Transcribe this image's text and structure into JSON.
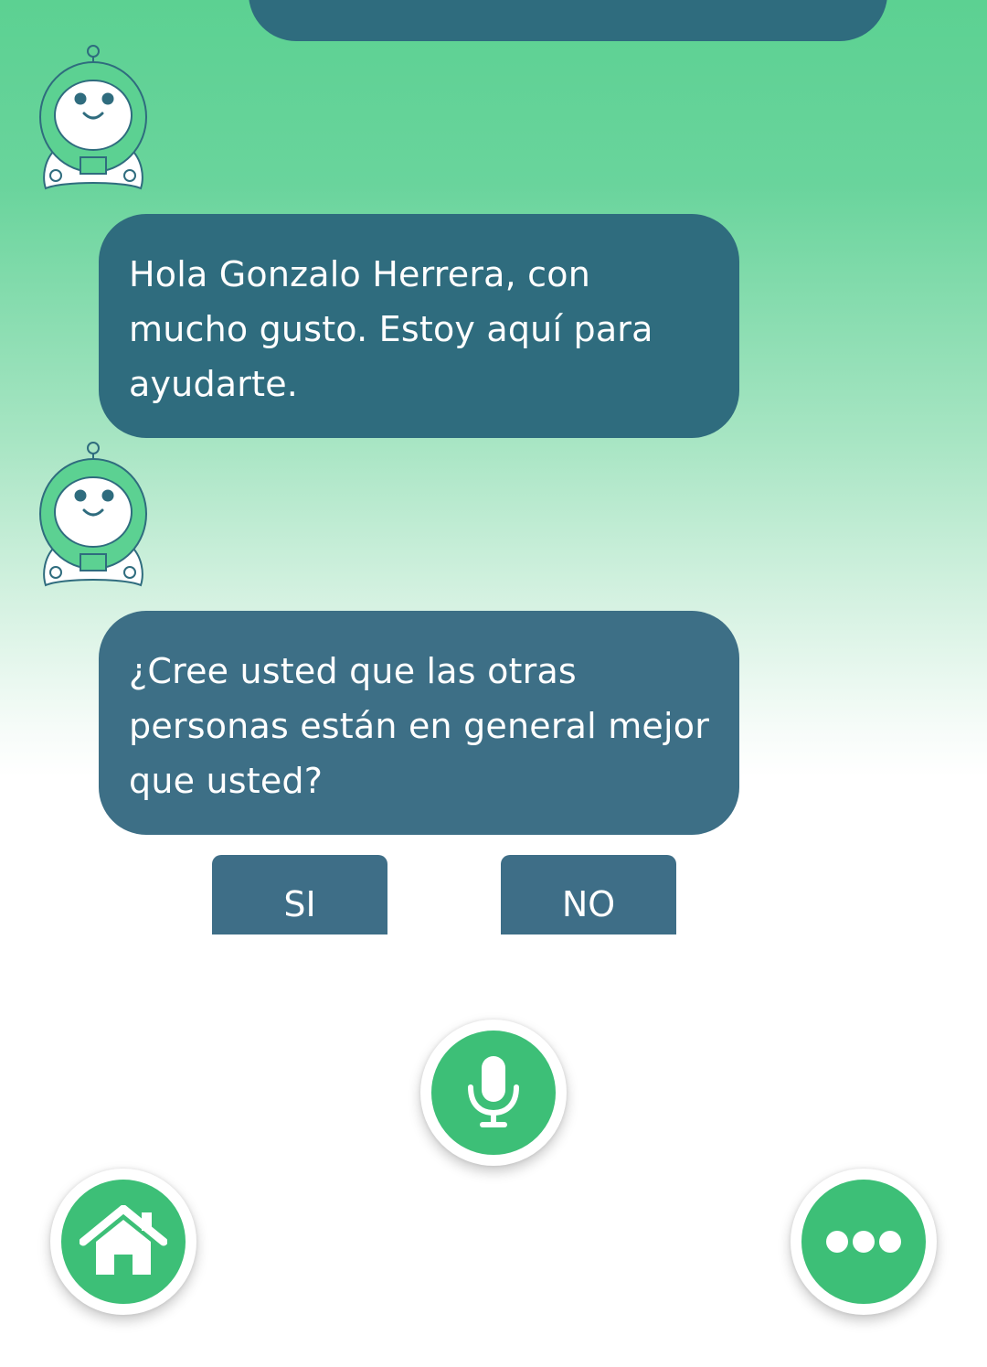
{
  "chat": {
    "messages": [
      {
        "sender": "bot",
        "text": "Hola Gonzalo Herrera, con mucho gusto. Estoy aquí para ayudarte."
      },
      {
        "sender": "bot",
        "text": "¿Cree usted que las otras personas están en general mejor que usted?"
      }
    ],
    "avatar_icon": "robot-avatar-icon"
  },
  "answers": {
    "yes_label": "SI",
    "no_label": "NO"
  },
  "controls": {
    "mic_icon": "microphone-icon",
    "home_icon": "home-icon",
    "more_icon": "more-dots-icon"
  },
  "colors": {
    "bubble": "#2f6c7e",
    "question_bubble": "#3d6f86",
    "accent_green": "#3dbf77",
    "gradient_top": "#5cd192"
  }
}
